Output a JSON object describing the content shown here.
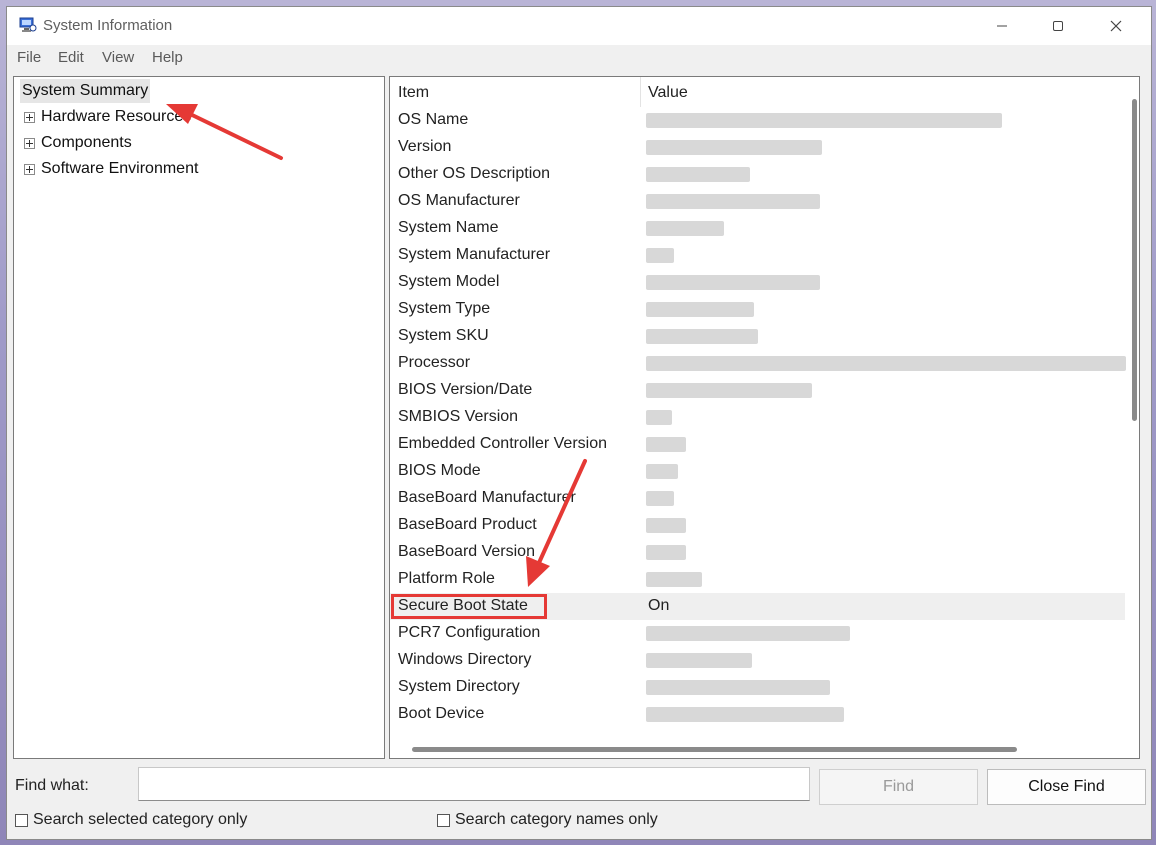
{
  "window": {
    "title": "System Information",
    "controls": {
      "minimize": "minimize-icon",
      "maximize": "maximize-icon",
      "close": "close-icon"
    }
  },
  "menu": [
    "File",
    "Edit",
    "View",
    "Help"
  ],
  "tree": {
    "root": "System Summary",
    "nodes": [
      "Hardware Resources",
      "Components",
      "Software Environment"
    ]
  },
  "list": {
    "headers": {
      "item": "Item",
      "value": "Value"
    },
    "rows": [
      {
        "item": "OS Name",
        "value": ""
      },
      {
        "item": "Version",
        "value": ""
      },
      {
        "item": "Other OS Description",
        "value": ""
      },
      {
        "item": "OS Manufacturer",
        "value": ""
      },
      {
        "item": "System Name",
        "value": ""
      },
      {
        "item": "System Manufacturer",
        "value": ""
      },
      {
        "item": "System Model",
        "value": ""
      },
      {
        "item": "System Type",
        "value": ""
      },
      {
        "item": "System SKU",
        "value": ""
      },
      {
        "item": "Processor",
        "value": ""
      },
      {
        "item": "BIOS Version/Date",
        "value": ""
      },
      {
        "item": "SMBIOS Version",
        "value": ""
      },
      {
        "item": "Embedded Controller Version",
        "value": ""
      },
      {
        "item": "BIOS Mode",
        "value": ""
      },
      {
        "item": "BaseBoard Manufacturer",
        "value": ""
      },
      {
        "item": "BaseBoard Product",
        "value": ""
      },
      {
        "item": "BaseBoard Version",
        "value": ""
      },
      {
        "item": "Platform Role",
        "value": ""
      },
      {
        "item": "Secure Boot State",
        "value": "On"
      },
      {
        "item": "PCR7 Configuration",
        "value": ""
      },
      {
        "item": "Windows Directory",
        "value": ""
      },
      {
        "item": "System Directory",
        "value": ""
      },
      {
        "item": "Boot Device",
        "value": ""
      }
    ],
    "selected_row": "Secure Boot State"
  },
  "find": {
    "label": "Find what:",
    "input_value": "",
    "find_button": "Find",
    "close_find_button": "Close Find",
    "search_selected_label": "Search selected category only",
    "search_names_label": "Search category names only"
  },
  "colors": {
    "annotation": "#e53935",
    "selection_bg": "#efefef",
    "window_bg": "#f0f0f0"
  }
}
